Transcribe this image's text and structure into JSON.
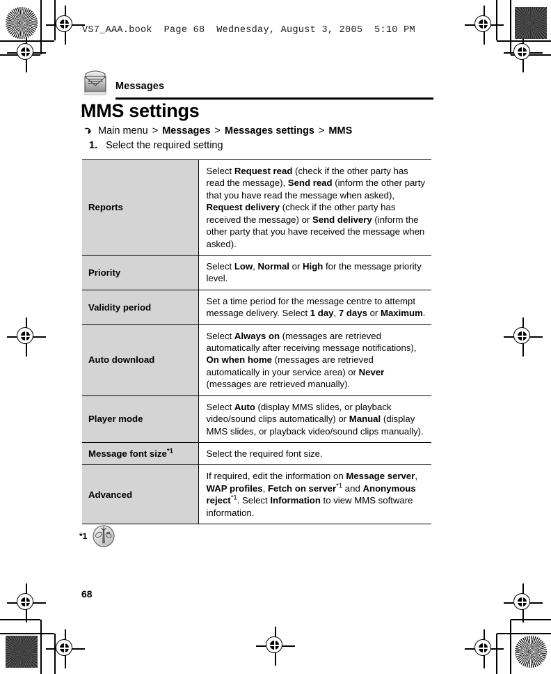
{
  "print_header": {
    "text": "VS7_AAA.book  Page 68  Wednesday, August 3, 2005  5:10 PM"
  },
  "chapter": {
    "icon": "envelope-icon",
    "name": "Messages"
  },
  "section": {
    "title": "MMS settings"
  },
  "nav_path": {
    "arrow_icon": "curved-arrow-icon",
    "root": "Main menu",
    "sep1": ">",
    "level1": "Messages",
    "sep2": ">",
    "level2": "Messages settings",
    "sep3": ">",
    "level3": "MMS"
  },
  "step": {
    "number": "1.",
    "text": "Select the required setting"
  },
  "table": {
    "rows": [
      {
        "label": "Reports",
        "label_footnote": "",
        "description_html": "Select <b>Request read</b> (check if the other party has read the message), <b>Send read</b> (inform the other party that you have read the message when asked), <b>Request delivery</b> (check if the other party has received the message) or <b>Send delivery</b> (inform the other party that you have received the message when asked)."
      },
      {
        "label": "Priority",
        "label_footnote": "",
        "description_html": "Select <b>Low</b>, <b>Normal</b> or <b>High</b> for the message priority level."
      },
      {
        "label": "Validity period",
        "label_footnote": "",
        "description_html": "Set a time period for the message centre to attempt message delivery. Select <b>1 day</b>, <b>7 days</b> or <b>Maximum</b>."
      },
      {
        "label": "Auto download",
        "label_footnote": "",
        "description_html": "Select <b>Always on</b> (messages are retrieved automatically after receiving message notifications), <b>On when home</b> (messages are retrieved automatically in your service area) or <b>Never</b> (messages are retrieved manually)."
      },
      {
        "label": "Player mode",
        "label_footnote": "",
        "description_html": "Select <b>Auto</b> (display MMS slides, or playback video/sound clips automatically) or <b>Manual</b> (display MMS slides, or playback video/sound clips manually)."
      },
      {
        "label": "Message font size",
        "label_footnote": "*1",
        "description_html": "Select the required font size."
      },
      {
        "label": "Advanced",
        "label_footnote": "",
        "description_html": "If required, edit the information on <b>Message server</b>, <b>WAP profiles</b>, <b>Fetch on server</b><sup class=\"fn\">*1</sup> and <b>Anonymous reject</b><sup class=\"fn\">*1</sup>. Select <b>Information</b> to view MMS software information."
      }
    ]
  },
  "footnote": {
    "mark": "*1",
    "icon": "network-service-icon"
  },
  "folio": {
    "page_number": "68"
  },
  "colors": {
    "label_cell_background": "#d4d4d4",
    "rule": "#000000",
    "page_background": "#ffffff"
  }
}
